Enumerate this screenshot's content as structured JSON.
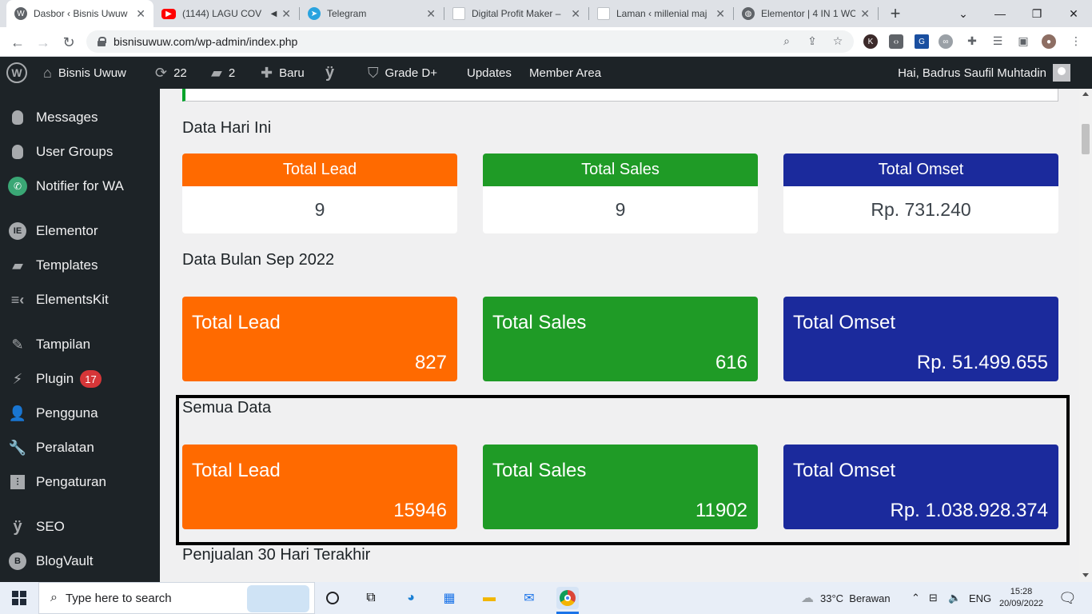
{
  "browser": {
    "tabs": [
      {
        "title": "Dasbor ‹ Bisnis Uwuw",
        "favicon": "wordpress-icon",
        "active": true
      },
      {
        "title": "(1144) LAGU COV",
        "favicon": "youtube-icon",
        "audio": "◀",
        "active": false
      },
      {
        "title": "Telegram",
        "favicon": "telegram-icon",
        "active": false
      },
      {
        "title": "Digital Profit Maker –",
        "favicon": "blank-page-icon",
        "active": false
      },
      {
        "title": "Laman ‹ millenial maj",
        "favicon": "blank-page-icon",
        "active": false
      },
      {
        "title": "Elementor | 4 IN 1 WC",
        "favicon": "globe-icon",
        "active": false
      }
    ],
    "new_tab_label": "+",
    "url": "bisnisuwuw.com/wp-admin/index.php",
    "ext_k_label": "K"
  },
  "adminbar": {
    "site_name": "Bisnis Uwuw",
    "updates_count": "22",
    "comments_count": "2",
    "new_label": "Baru",
    "grade_label": "Grade D+",
    "updates_label": "Updates",
    "member_label": "Member Area",
    "greeting": "Hai, Badrus Saufil Muhtadin"
  },
  "sidebar": {
    "items": [
      {
        "label": "Messages",
        "icon": "leaf-icon"
      },
      {
        "label": "User Groups",
        "icon": "leaf-icon"
      },
      {
        "label": "Notifier for WA",
        "icon": "whatsapp-icon"
      },
      {
        "label": "Elementor",
        "icon": "elementor-icon"
      },
      {
        "label": "Templates",
        "icon": "folder-icon"
      },
      {
        "label": "ElementsKit",
        "icon": "elementskit-icon"
      },
      {
        "label": "Tampilan",
        "icon": "brush-icon"
      },
      {
        "label": "Plugin",
        "icon": "plugin-icon",
        "badge": "17"
      },
      {
        "label": "Pengguna",
        "icon": "user-icon"
      },
      {
        "label": "Peralatan",
        "icon": "wrench-icon"
      },
      {
        "label": "Pengaturan",
        "icon": "sliders-icon"
      },
      {
        "label": "SEO",
        "icon": "yoast-icon"
      },
      {
        "label": "BlogVault",
        "icon": "blogvault-icon"
      }
    ]
  },
  "dashboard": {
    "today": {
      "title": "Data Hari Ini",
      "lead_label": "Total Lead",
      "lead_value": "9",
      "sales_label": "Total Sales",
      "sales_value": "9",
      "omset_label": "Total Omset",
      "omset_value": "Rp. 731.240"
    },
    "month": {
      "title": "Data Bulan Sep 2022",
      "lead_label": "Total Lead",
      "lead_value": "827",
      "sales_label": "Total Sales",
      "sales_value": "616",
      "omset_label": "Total Omset",
      "omset_value": "Rp. 51.499.655"
    },
    "all": {
      "title": "Semua Data",
      "lead_label": "Total Lead",
      "lead_value": "15946",
      "sales_label": "Total Sales",
      "sales_value": "11902",
      "omset_label": "Total Omset",
      "omset_value": "Rp. 1.038.928.374"
    },
    "last30_title": "Penjualan 30 Hari Terakhir"
  },
  "colors": {
    "lead": "#ff6a00",
    "sales": "#1f9b26",
    "omset": "#1b2a9c"
  },
  "taskbar": {
    "search_placeholder": "Type here to search",
    "weather": "33°C  Berawan",
    "language": "ENG",
    "time": "15:28",
    "date": "20/09/2022"
  }
}
